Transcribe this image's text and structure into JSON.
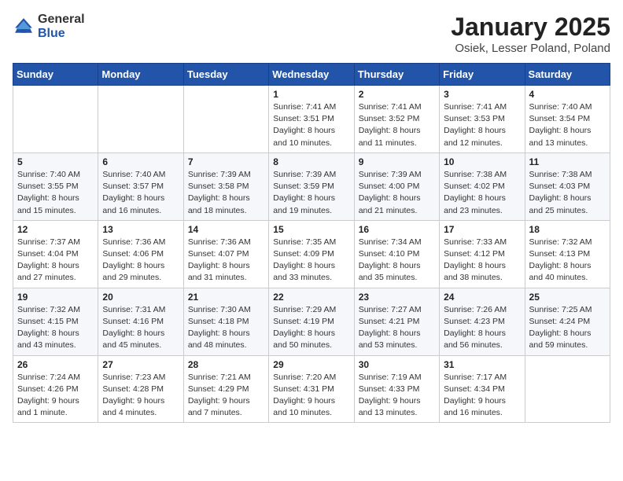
{
  "logo": {
    "general": "General",
    "blue": "Blue"
  },
  "header": {
    "month": "January 2025",
    "location": "Osiek, Lesser Poland, Poland"
  },
  "weekdays": [
    "Sunday",
    "Monday",
    "Tuesday",
    "Wednesday",
    "Thursday",
    "Friday",
    "Saturday"
  ],
  "weeks": [
    [
      {
        "day": "",
        "detail": ""
      },
      {
        "day": "",
        "detail": ""
      },
      {
        "day": "",
        "detail": ""
      },
      {
        "day": "1",
        "detail": "Sunrise: 7:41 AM\nSunset: 3:51 PM\nDaylight: 8 hours\nand 10 minutes."
      },
      {
        "day": "2",
        "detail": "Sunrise: 7:41 AM\nSunset: 3:52 PM\nDaylight: 8 hours\nand 11 minutes."
      },
      {
        "day": "3",
        "detail": "Sunrise: 7:41 AM\nSunset: 3:53 PM\nDaylight: 8 hours\nand 12 minutes."
      },
      {
        "day": "4",
        "detail": "Sunrise: 7:40 AM\nSunset: 3:54 PM\nDaylight: 8 hours\nand 13 minutes."
      }
    ],
    [
      {
        "day": "5",
        "detail": "Sunrise: 7:40 AM\nSunset: 3:55 PM\nDaylight: 8 hours\nand 15 minutes."
      },
      {
        "day": "6",
        "detail": "Sunrise: 7:40 AM\nSunset: 3:57 PM\nDaylight: 8 hours\nand 16 minutes."
      },
      {
        "day": "7",
        "detail": "Sunrise: 7:39 AM\nSunset: 3:58 PM\nDaylight: 8 hours\nand 18 minutes."
      },
      {
        "day": "8",
        "detail": "Sunrise: 7:39 AM\nSunset: 3:59 PM\nDaylight: 8 hours\nand 19 minutes."
      },
      {
        "day": "9",
        "detail": "Sunrise: 7:39 AM\nSunset: 4:00 PM\nDaylight: 8 hours\nand 21 minutes."
      },
      {
        "day": "10",
        "detail": "Sunrise: 7:38 AM\nSunset: 4:02 PM\nDaylight: 8 hours\nand 23 minutes."
      },
      {
        "day": "11",
        "detail": "Sunrise: 7:38 AM\nSunset: 4:03 PM\nDaylight: 8 hours\nand 25 minutes."
      }
    ],
    [
      {
        "day": "12",
        "detail": "Sunrise: 7:37 AM\nSunset: 4:04 PM\nDaylight: 8 hours\nand 27 minutes."
      },
      {
        "day": "13",
        "detail": "Sunrise: 7:36 AM\nSunset: 4:06 PM\nDaylight: 8 hours\nand 29 minutes."
      },
      {
        "day": "14",
        "detail": "Sunrise: 7:36 AM\nSunset: 4:07 PM\nDaylight: 8 hours\nand 31 minutes."
      },
      {
        "day": "15",
        "detail": "Sunrise: 7:35 AM\nSunset: 4:09 PM\nDaylight: 8 hours\nand 33 minutes."
      },
      {
        "day": "16",
        "detail": "Sunrise: 7:34 AM\nSunset: 4:10 PM\nDaylight: 8 hours\nand 35 minutes."
      },
      {
        "day": "17",
        "detail": "Sunrise: 7:33 AM\nSunset: 4:12 PM\nDaylight: 8 hours\nand 38 minutes."
      },
      {
        "day": "18",
        "detail": "Sunrise: 7:32 AM\nSunset: 4:13 PM\nDaylight: 8 hours\nand 40 minutes."
      }
    ],
    [
      {
        "day": "19",
        "detail": "Sunrise: 7:32 AM\nSunset: 4:15 PM\nDaylight: 8 hours\nand 43 minutes."
      },
      {
        "day": "20",
        "detail": "Sunrise: 7:31 AM\nSunset: 4:16 PM\nDaylight: 8 hours\nand 45 minutes."
      },
      {
        "day": "21",
        "detail": "Sunrise: 7:30 AM\nSunset: 4:18 PM\nDaylight: 8 hours\nand 48 minutes."
      },
      {
        "day": "22",
        "detail": "Sunrise: 7:29 AM\nSunset: 4:19 PM\nDaylight: 8 hours\nand 50 minutes."
      },
      {
        "day": "23",
        "detail": "Sunrise: 7:27 AM\nSunset: 4:21 PM\nDaylight: 8 hours\nand 53 minutes."
      },
      {
        "day": "24",
        "detail": "Sunrise: 7:26 AM\nSunset: 4:23 PM\nDaylight: 8 hours\nand 56 minutes."
      },
      {
        "day": "25",
        "detail": "Sunrise: 7:25 AM\nSunset: 4:24 PM\nDaylight: 8 hours\nand 59 minutes."
      }
    ],
    [
      {
        "day": "26",
        "detail": "Sunrise: 7:24 AM\nSunset: 4:26 PM\nDaylight: 9 hours\nand 1 minute."
      },
      {
        "day": "27",
        "detail": "Sunrise: 7:23 AM\nSunset: 4:28 PM\nDaylight: 9 hours\nand 4 minutes."
      },
      {
        "day": "28",
        "detail": "Sunrise: 7:21 AM\nSunset: 4:29 PM\nDaylight: 9 hours\nand 7 minutes."
      },
      {
        "day": "29",
        "detail": "Sunrise: 7:20 AM\nSunset: 4:31 PM\nDaylight: 9 hours\nand 10 minutes."
      },
      {
        "day": "30",
        "detail": "Sunrise: 7:19 AM\nSunset: 4:33 PM\nDaylight: 9 hours\nand 13 minutes."
      },
      {
        "day": "31",
        "detail": "Sunrise: 7:17 AM\nSunset: 4:34 PM\nDaylight: 9 hours\nand 16 minutes."
      },
      {
        "day": "",
        "detail": ""
      }
    ]
  ]
}
